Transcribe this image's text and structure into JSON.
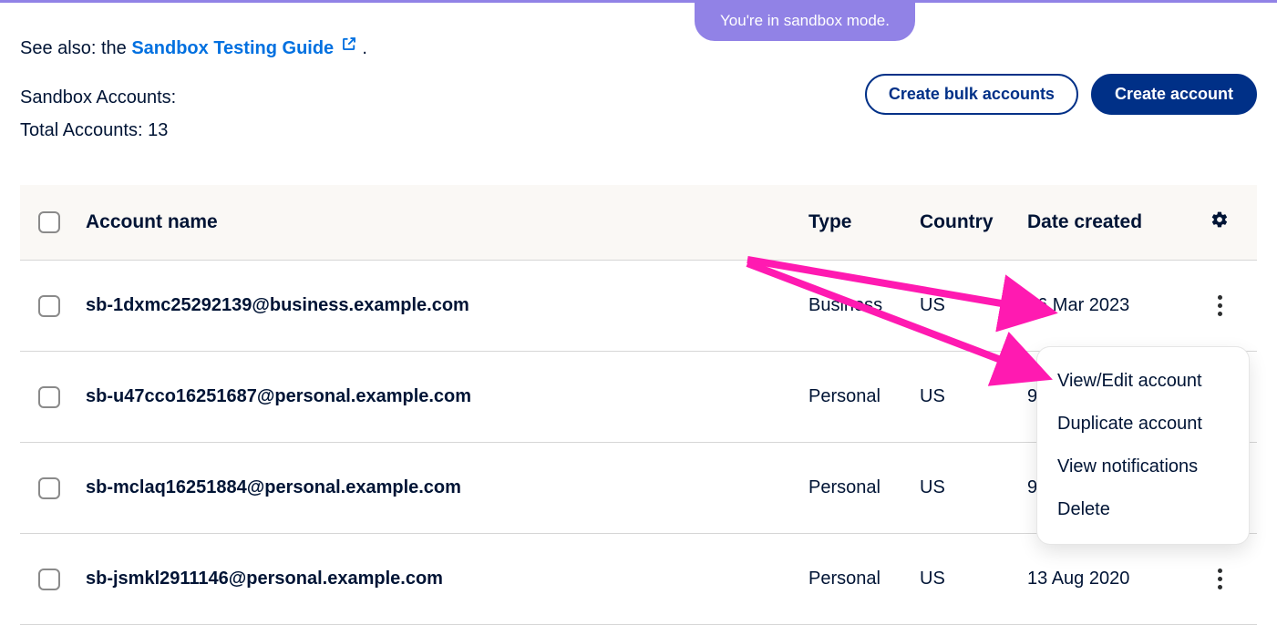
{
  "sandbox_badge": "You're in sandbox mode.",
  "see_also_prefix": "See also: the ",
  "see_also_link": "Sandbox Testing Guide",
  "see_also_suffix": " .",
  "summary": {
    "line1": "Sandbox Accounts:",
    "line2": "Total Accounts: 13"
  },
  "buttons": {
    "create_bulk": "Create bulk accounts",
    "create_account": "Create account"
  },
  "columns": {
    "name": "Account name",
    "type": "Type",
    "country": "Country",
    "date": "Date created"
  },
  "rows": [
    {
      "name": "sb-1dxmc25292139@business.example.com",
      "type": "Business",
      "country": "US",
      "date": "16 Mar 2023"
    },
    {
      "name": "sb-u47cco16251687@personal.example.com",
      "type": "Personal",
      "country": "US",
      "date": "9 May 2022"
    },
    {
      "name": "sb-mclaq16251884@personal.example.com",
      "type": "Personal",
      "country": "US",
      "date": "9 May 2022"
    },
    {
      "name": "sb-jsmkl2911146@personal.example.com",
      "type": "Personal",
      "country": "US",
      "date": "13 Aug 2020"
    }
  ],
  "dropdown": {
    "view_edit": "View/Edit account",
    "duplicate": "Duplicate account",
    "notifications": "View notifications",
    "delete": "Delete"
  }
}
